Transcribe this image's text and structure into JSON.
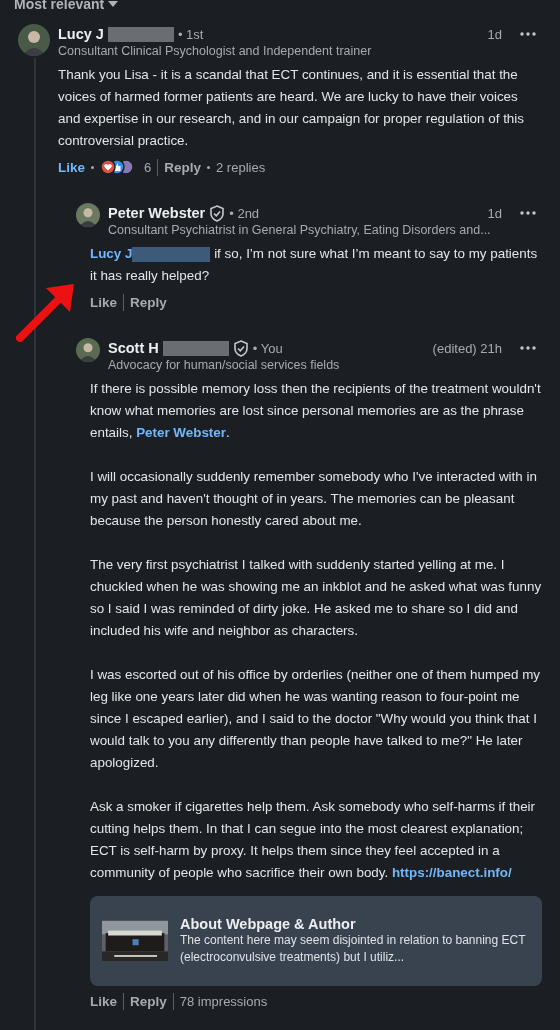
{
  "sort": {
    "label": "Most relevant"
  },
  "comment": {
    "author": "Lucy J",
    "redacted": true,
    "verified": false,
    "degree": "• 1st",
    "headline": "Consultant Clinical Psychologist and Independent trainer",
    "time": "1d",
    "paragraphs": [
      [
        {
          "kind": "text",
          "text": "Thank you Lisa - it is a scandal that ECT continues, and it is essential that the voices of harmed former patients are heard. We are lucky to have their voices and expertise in our research, and in our campaign for proper regulation of this controversial practice."
        }
      ]
    ],
    "liked": true,
    "like_label": "Like",
    "reply_label": "Reply",
    "reactions": "6",
    "replies_count": "2 replies",
    "replies": [
      {
        "author": "Peter Webster",
        "redacted": false,
        "verified": true,
        "degree": "• 2nd",
        "headline": "Consultant Psychiatrist in General Psychiatry, Eating Disorders and...",
        "time": "1d",
        "paragraphs": [
          [
            {
              "kind": "mention",
              "text": "Lucy J",
              "redacted": true
            },
            {
              "kind": "text",
              "text": " if so, I’m not sure what I’m meant to say to my patients it has really helped?"
            }
          ]
        ],
        "liked": false,
        "like_label": "Like",
        "reply_label": "Reply"
      },
      {
        "author": "Scott H",
        "redacted": true,
        "verified": true,
        "degree": "• You",
        "headline": "Advocacy for human/social services fields",
        "time": "(edited) 21h",
        "paragraphs": [
          [
            {
              "kind": "text",
              "text": "If there is possible memory loss then the recipients of the treatment wouldn't know what memories are lost since personal memories are as the phrase entails, "
            },
            {
              "kind": "mention",
              "text": "Peter Webster",
              "redacted": false
            },
            {
              "kind": "text",
              "text": "."
            }
          ],
          [
            {
              "kind": "text",
              "text": "I will occasionally suddenly remember somebody who I've interacted with in my past and haven't thought of in years. The memories can be pleasant because the person honestly cared about me."
            }
          ],
          [
            {
              "kind": "text",
              "text": "The very first psychiatrist I talked with suddenly started yelling at me. I chuckled when he was showing me an inkblot and he asked what was funny so I said I was reminded of dirty joke. He asked me to share so I did and included his wife and neighbor as characters."
            }
          ],
          [
            {
              "kind": "text",
              "text": "I was escorted out of his office by orderlies (neither one of them humped my leg like one years later did when he was wanting reason to four-point me since I escaped earlier), and I said to the doctor \"Why would you think that I would talk to you any differently than people have talked to me?\" He later apologized."
            }
          ],
          [
            {
              "kind": "text",
              "text": "Ask a smoker if cigarettes help them. Ask somebody who self-harms if their cutting helps them. In that I can segue into the most clearest explanation; ECT is self-harm by proxy. It helps them since they feel accepted in a community of people who sacrifice their own body. "
            },
            {
              "kind": "link",
              "text": "https://banect.info/"
            }
          ]
        ],
        "preview": {
          "title": "About Webpage & Author",
          "description": "The content here may seem disjointed in relation to banning ECT (electroconvulsive treatments) but I utiliz..."
        },
        "liked": false,
        "like_label": "Like",
        "reply_label": "Reply",
        "impressions": "78 impressions"
      }
    ]
  }
}
